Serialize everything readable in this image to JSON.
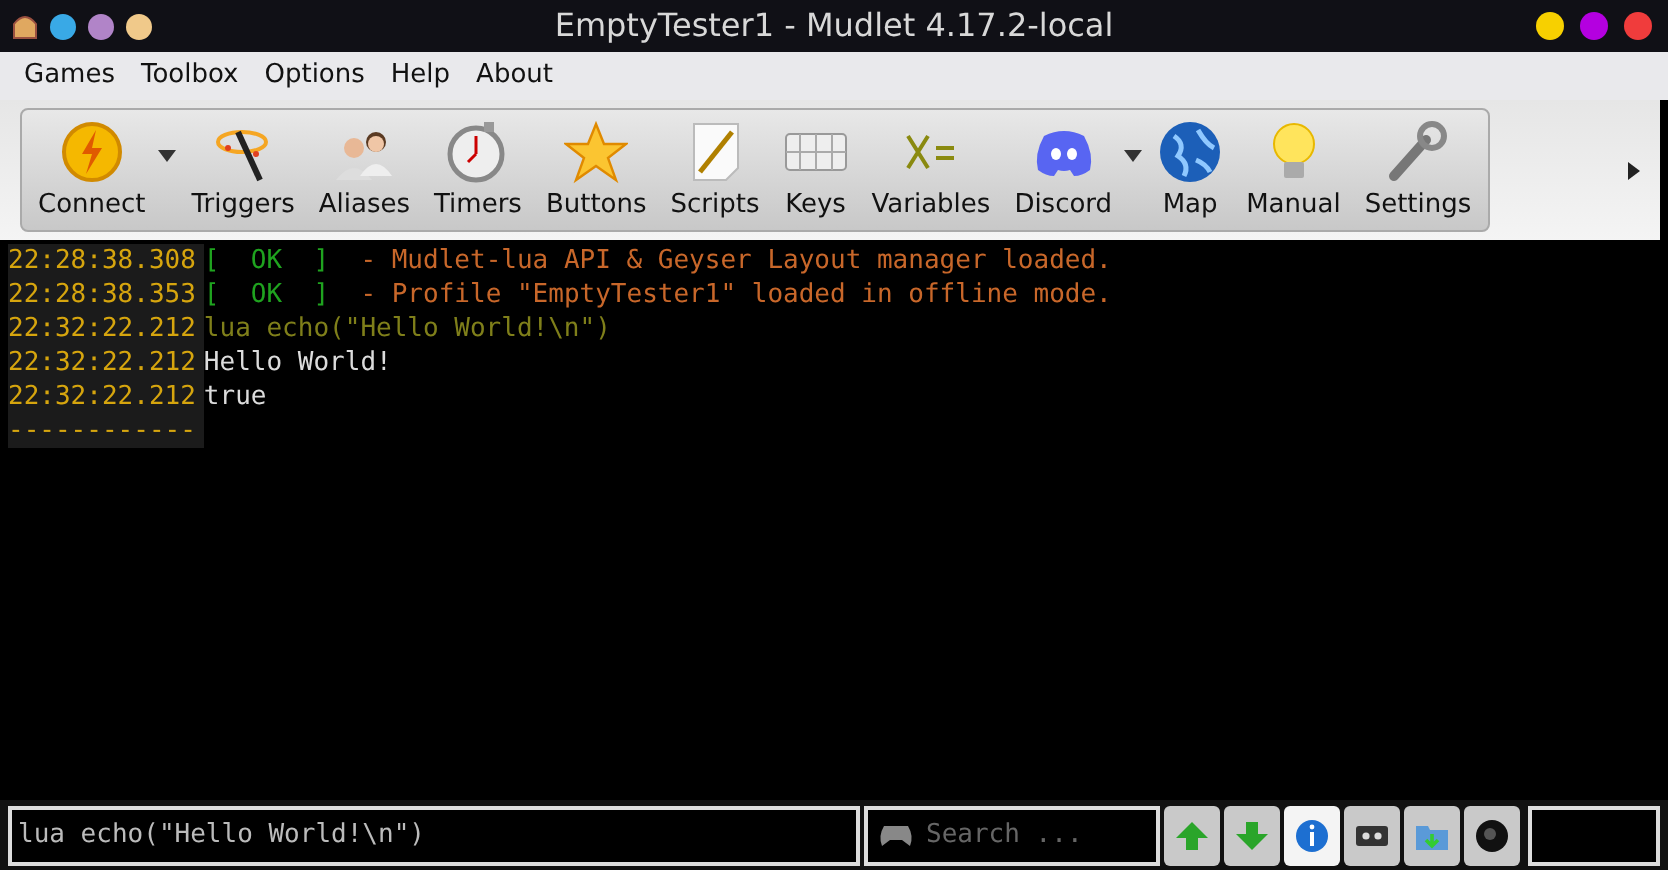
{
  "window": {
    "title": "EmptyTester1 - Mudlet 4.17.2-local"
  },
  "menu": [
    "Games",
    "Toolbox",
    "Options",
    "Help",
    "About"
  ],
  "toolbar": [
    {
      "label": "Connect",
      "dropdown": true
    },
    {
      "label": "Triggers",
      "dropdown": false
    },
    {
      "label": "Aliases",
      "dropdown": false
    },
    {
      "label": "Timers",
      "dropdown": false
    },
    {
      "label": "Buttons",
      "dropdown": false
    },
    {
      "label": "Scripts",
      "dropdown": false
    },
    {
      "label": "Keys",
      "dropdown": false
    },
    {
      "label": "Variables",
      "dropdown": false
    },
    {
      "label": "Discord",
      "dropdown": true
    },
    {
      "label": "Map",
      "dropdown": false
    },
    {
      "label": "Manual",
      "dropdown": false
    },
    {
      "label": "Settings",
      "dropdown": false
    }
  ],
  "console": [
    {
      "timestamp": "22:28:38.308",
      "segments": [
        {
          "text": "[  OK  ]",
          "color": "#1fa31f"
        },
        {
          "text": "  - Mudlet-lua API & Geyser Layout manager loaded.",
          "color": "#c8672a"
        }
      ]
    },
    {
      "timestamp": "22:28:38.353",
      "segments": [
        {
          "text": "[  OK  ]",
          "color": "#1fa31f"
        },
        {
          "text": "  - Profile \"EmptyTester1\" loaded in offline mode.",
          "color": "#c8672a"
        }
      ]
    },
    {
      "timestamp": "22:32:22.212",
      "segments": [
        {
          "text": "lua echo(\"Hello World!\\n\")",
          "color": "#7f7f1a"
        }
      ]
    },
    {
      "timestamp": "22:32:22.212",
      "segments": [
        {
          "text": "Hello World!",
          "color": "#dcdcdc"
        }
      ]
    },
    {
      "timestamp": "22:32:22.212",
      "segments": [
        {
          "text": "true",
          "color": "#dcdcdc"
        }
      ]
    },
    {
      "timestamp": "------------"
    }
  ],
  "command_input": {
    "value": "lua echo(\"Hello World!\\n\")"
  },
  "search": {
    "placeholder": "Search ..."
  },
  "buttons": [
    {
      "selected": false
    },
    {
      "selected": false
    },
    {
      "selected": true
    },
    {
      "selected": false
    },
    {
      "selected": false
    },
    {
      "selected": false
    }
  ]
}
